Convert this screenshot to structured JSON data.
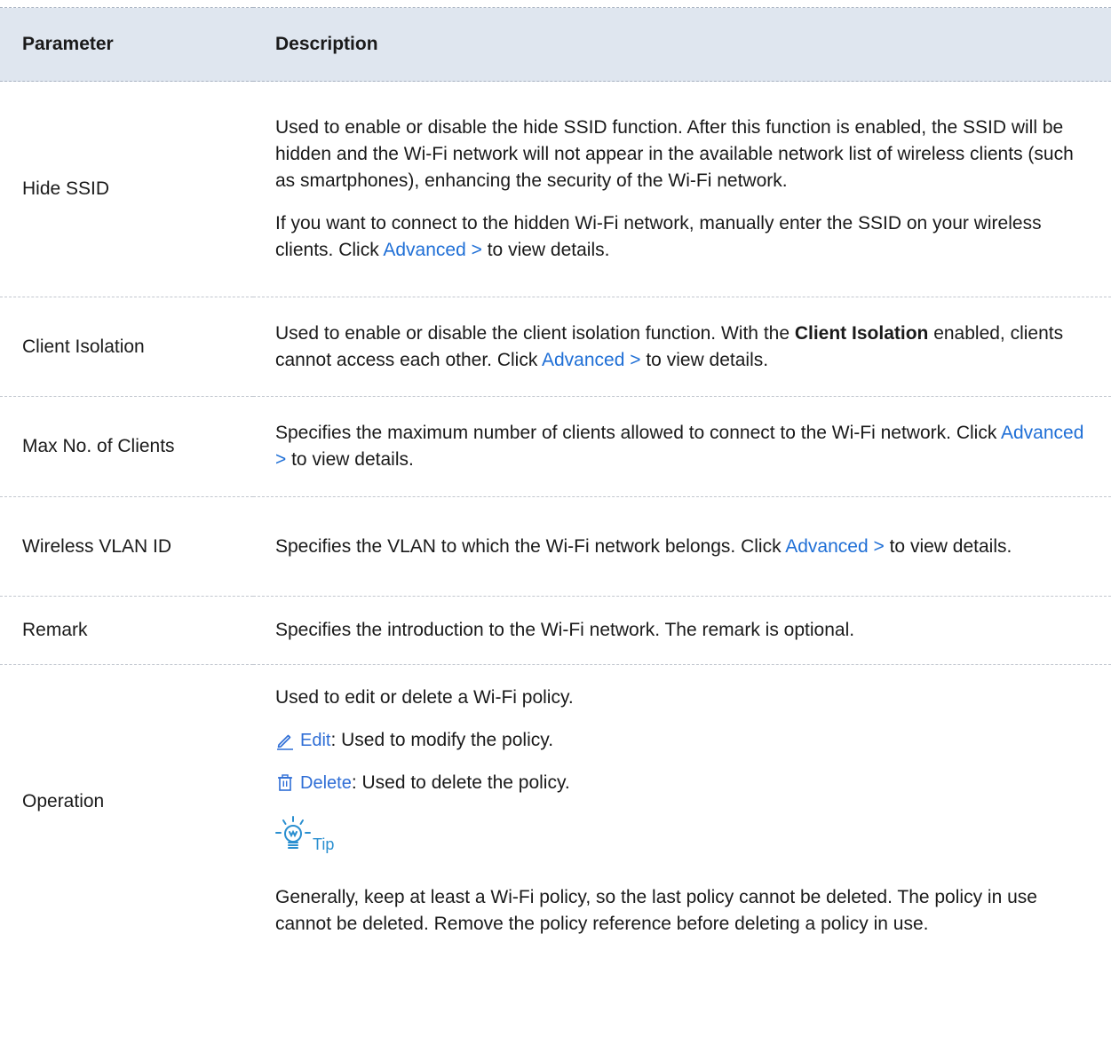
{
  "header": {
    "param": "Parameter",
    "desc": "Description"
  },
  "link_text": "Advanced >",
  "rows": {
    "hide_ssid": {
      "param": "Hide SSID",
      "p1": "Used to enable or disable the hide SSID function. After this function is enabled, the SSID will be hidden and the Wi-Fi network will not appear in the available network list of wireless clients (such as smartphones), enhancing the security of the Wi-Fi network.",
      "p2_a": "If you want to connect to the hidden Wi-Fi network, manually enter the SSID on your wireless clients. Click ",
      "p2_b": " to view details."
    },
    "client_isolation": {
      "param": "Client Isolation",
      "a": "Used to enable or disable the client isolation function. With the ",
      "bold": "Client Isolation",
      "b": " enabled, clients cannot access each other. Click ",
      "c": " to view details."
    },
    "max_clients": {
      "param": "Max No. of Clients",
      "a": "Specifies the maximum number of clients allowed to connect to the Wi-Fi network. Click ",
      "b": " to view details."
    },
    "vlan": {
      "param": "Wireless VLAN ID",
      "a": "Specifies the VLAN to which the Wi-Fi network belongs. Click ",
      "b": " to view details."
    },
    "remark": {
      "param": "Remark",
      "desc": "Specifies the introduction to the Wi-Fi network. The remark is optional."
    },
    "operation": {
      "param": "Operation",
      "intro": "Used to edit or delete a Wi-Fi policy.",
      "edit_label": "Edit",
      "edit_desc": ": Used to modify the policy.",
      "delete_label": "Delete",
      "delete_desc": ": Used to delete the policy.",
      "tip_label": "Tip",
      "tip_text": "Generally, keep at least a Wi-Fi policy, so the last policy cannot be deleted. The policy in use cannot be deleted. Remove the policy reference before deleting a policy in use."
    }
  },
  "colors": {
    "header_bg": "#dfe6ef",
    "link": "#1f6fd6",
    "icon_blue": "#2f6ed6",
    "tip_blue": "#2a8fd0"
  },
  "icons": {
    "edit": "pencil-icon",
    "delete": "trash-icon",
    "tip": "lightbulb-icon"
  }
}
